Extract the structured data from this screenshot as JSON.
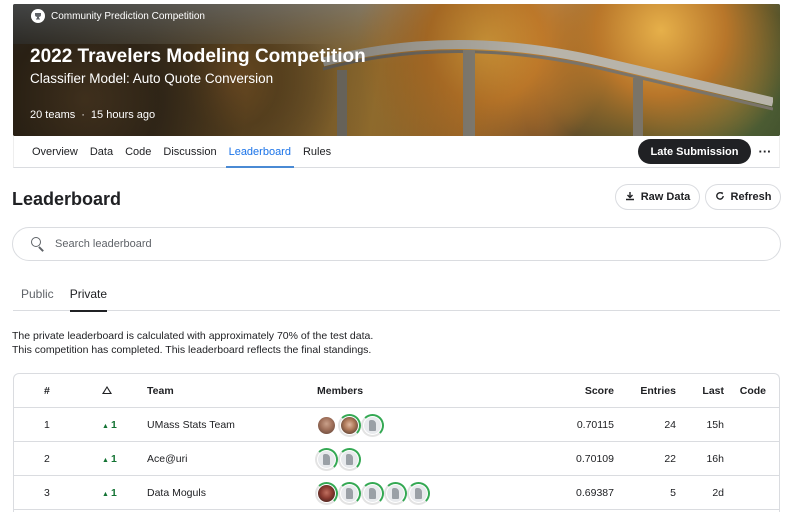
{
  "banner": {
    "badge": "Community Prediction Competition",
    "title": "2022 Travelers Modeling Competition",
    "subtitle": "Classifier Model: Auto Quote Conversion",
    "teams": "20 teams",
    "time_ago": "15 hours ago"
  },
  "nav": {
    "tabs": [
      "Overview",
      "Data",
      "Code",
      "Discussion",
      "Leaderboard",
      "Rules"
    ],
    "active_tab": "Leaderboard",
    "late_submission": "Late Submission",
    "more": "···"
  },
  "leaderboard": {
    "title": "Leaderboard",
    "raw_data": "Raw Data",
    "refresh": "Refresh",
    "search_placeholder": "Search leaderboard",
    "tabs": [
      "Public",
      "Private"
    ],
    "active_tab": "Private",
    "desc_line1": "The private leaderboard is calculated with approximately 70% of the test data.",
    "desc_line2": "This competition has completed. This leaderboard reflects the final standings."
  },
  "table": {
    "headers": {
      "rank": "#",
      "team": "Team",
      "members": "Members",
      "score": "Score",
      "entries": "Entries",
      "last": "Last",
      "code": "Code"
    },
    "rows": [
      {
        "rank": "1",
        "change": "1",
        "team": "UMass Stats Team",
        "score": "0.70115",
        "entries": "24",
        "last": "15h",
        "avatars": [
          "photo",
          "photo2",
          "default"
        ]
      },
      {
        "rank": "2",
        "change": "1",
        "team": "Ace@uri",
        "score": "0.70109",
        "entries": "22",
        "last": "16h",
        "avatars": [
          "default",
          "default"
        ]
      },
      {
        "rank": "3",
        "change": "1",
        "team": "Data Moguls",
        "score": "0.69387",
        "entries": "5",
        "last": "2d",
        "avatars": [
          "photo3",
          "default",
          "default",
          "default",
          "default"
        ]
      }
    ]
  },
  "colors": {
    "accent": "#1a73e8",
    "positive_change": "#137333",
    "button_dark": "#202124"
  }
}
